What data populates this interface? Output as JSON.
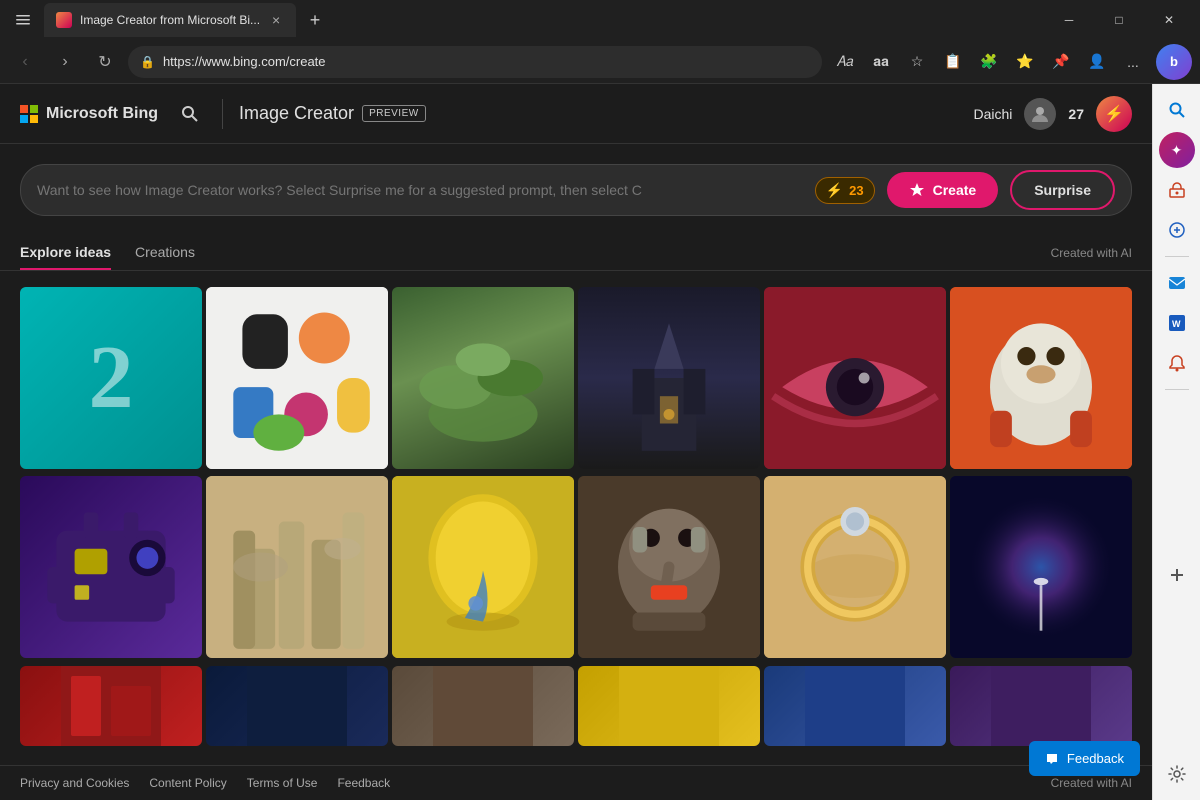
{
  "browser": {
    "tab_title": "Image Creator from Microsoft Bi...",
    "tab_close": "×",
    "new_tab": "+",
    "back": "‹",
    "forward": "›",
    "refresh": "↻",
    "address": "https://www.bing.com/create",
    "more": "...",
    "bing_btn_label": "b"
  },
  "header": {
    "ms_bing_label": "Microsoft Bing",
    "image_creator_label": "Image Creator",
    "preview_badge": "PREVIEW",
    "user_name": "Daichi",
    "boost_count": "27"
  },
  "prompt": {
    "placeholder": "Want to see how Image Creator works? Select Surprise me for a suggested prompt, then select C",
    "boost_count": "23",
    "create_label": "Create",
    "surprise_label": "Surprise"
  },
  "tabs": {
    "explore": "Explore ideas",
    "creations": "Creations",
    "created_with_ai": "Created with AI"
  },
  "images": [
    {
      "id": "teal-2",
      "class": "img-teal-2",
      "alt": "Number 2 on teal background"
    },
    {
      "id": "shapes",
      "class": "img-shapes",
      "alt": "Colorful abstract shapes"
    },
    {
      "id": "succulents",
      "class": "img-succulents",
      "alt": "Succulents in hands"
    },
    {
      "id": "castle",
      "class": "img-castle",
      "alt": "Dark fantasy castle"
    },
    {
      "id": "eye",
      "class": "img-eye",
      "alt": "Close up of eye with colorful makeup"
    },
    {
      "id": "dog-astro",
      "class": "img-dog-astro",
      "alt": "Dog astronaut"
    },
    {
      "id": "robot",
      "class": "img-robot",
      "alt": "Purple robot camera"
    },
    {
      "id": "city",
      "class": "img-city",
      "alt": "Futuristic sci-fi city"
    },
    {
      "id": "lemon",
      "class": "img-lemon",
      "alt": "Lemon with water drop"
    },
    {
      "id": "elephant",
      "class": "img-elephant",
      "alt": "Elephant in suit"
    },
    {
      "id": "ring",
      "class": "img-ring",
      "alt": "Gold ring with gemstone"
    },
    {
      "id": "space",
      "class": "img-space",
      "alt": "Space nebula with figure"
    },
    {
      "id": "red-partial",
      "class": "img-red-partial",
      "alt": "Red partial image"
    },
    {
      "id": "night-partial",
      "class": "img-night-partial",
      "alt": "Night city partial"
    },
    {
      "id": "person-partial",
      "class": "img-person-partial",
      "alt": "Person partial"
    },
    {
      "id": "yellow-partial",
      "class": "img-yellow-partial",
      "alt": "Yellow partial"
    },
    {
      "id": "blue-partial",
      "class": "img-blue-partial",
      "alt": "Blue partial"
    },
    {
      "id": "partial6",
      "class": "img-partial6",
      "alt": "Partial image 6"
    }
  ],
  "footer": {
    "privacy": "Privacy and Cookies",
    "content": "Content Policy",
    "terms": "Terms of Use",
    "feedback": "Feedback",
    "created_with_ai": "Created with AI",
    "feedback_btn": "Feedback"
  },
  "sidebar": {
    "icons": [
      "🔍",
      "🎨",
      "🧰",
      "🤖",
      "📊",
      "📬",
      "M",
      "W",
      "🔔",
      "+",
      "⚙️"
    ]
  }
}
